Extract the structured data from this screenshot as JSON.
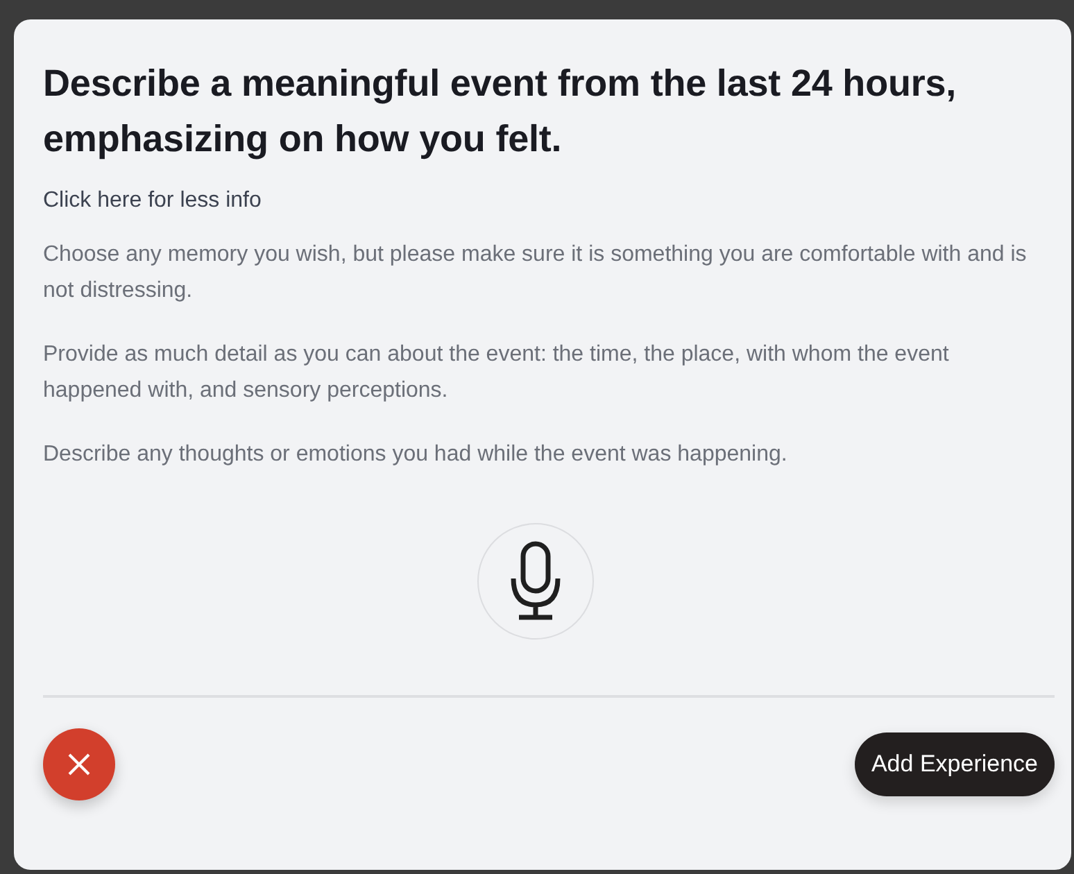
{
  "prompt": {
    "title": "Describe a meaningful event from the last 24 hours, emphasizing on how you felt.",
    "info_link": "Click here for less info",
    "paragraphs": [
      "Choose any memory you wish, but please make sure it is something you are comfortable with and is not distressing.",
      "Provide as much detail as you can about the event: the time, the place, with whom the event happened with, and sensory perceptions.",
      "Describe any thoughts or emotions you had while the event was happening."
    ]
  },
  "actions": {
    "submit_label": "Add Experience"
  }
}
